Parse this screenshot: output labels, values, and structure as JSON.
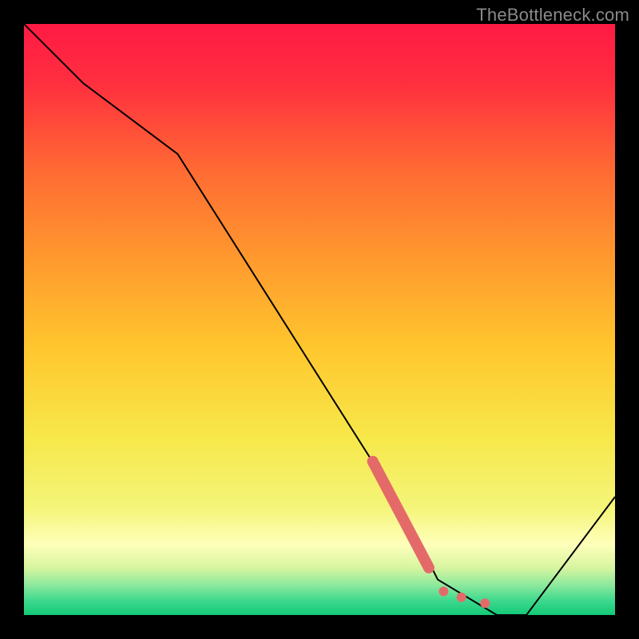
{
  "watermark": "TheBottleneck.com",
  "chart_data": {
    "type": "line",
    "title": "",
    "xlabel": "",
    "ylabel": "",
    "xlim": [
      0,
      100
    ],
    "ylim": [
      0,
      100
    ],
    "grid": false,
    "series": [
      {
        "name": "bottleneck-curve",
        "x": [
          0,
          10,
          26,
          64,
          70,
          80,
          85,
          100
        ],
        "values": [
          100,
          90,
          78,
          18,
          6,
          0,
          0,
          20
        ],
        "color": "#000000",
        "stroke_width": 2
      }
    ],
    "highlight_segment": {
      "description": "thick salmon segment along curve",
      "x": [
        59,
        68.5
      ],
      "values": [
        26,
        8
      ],
      "color": "#e46a6a",
      "stroke_width": 14
    },
    "highlight_dots": {
      "description": "salmon dots near curve trough",
      "points": [
        {
          "x": 71,
          "y": 4
        },
        {
          "x": 74,
          "y": 3
        },
        {
          "x": 78,
          "y": 2
        }
      ],
      "color": "#e46a6a",
      "radius": 6
    },
    "background_gradient": {
      "type": "vertical",
      "stops": [
        {
          "offset": 0.0,
          "color": "#ff1a44"
        },
        {
          "offset": 0.1,
          "color": "#ff2f3f"
        },
        {
          "offset": 0.25,
          "color": "#ff6b33"
        },
        {
          "offset": 0.4,
          "color": "#ff9a2e"
        },
        {
          "offset": 0.55,
          "color": "#ffc72e"
        },
        {
          "offset": 0.7,
          "color": "#f7e84a"
        },
        {
          "offset": 0.82,
          "color": "#f4f57a"
        },
        {
          "offset": 0.88,
          "color": "#ffffba"
        },
        {
          "offset": 0.92,
          "color": "#d7f5a0"
        },
        {
          "offset": 0.95,
          "color": "#8ae89c"
        },
        {
          "offset": 0.975,
          "color": "#3fd98e"
        },
        {
          "offset": 1.0,
          "color": "#13c977"
        }
      ]
    }
  }
}
